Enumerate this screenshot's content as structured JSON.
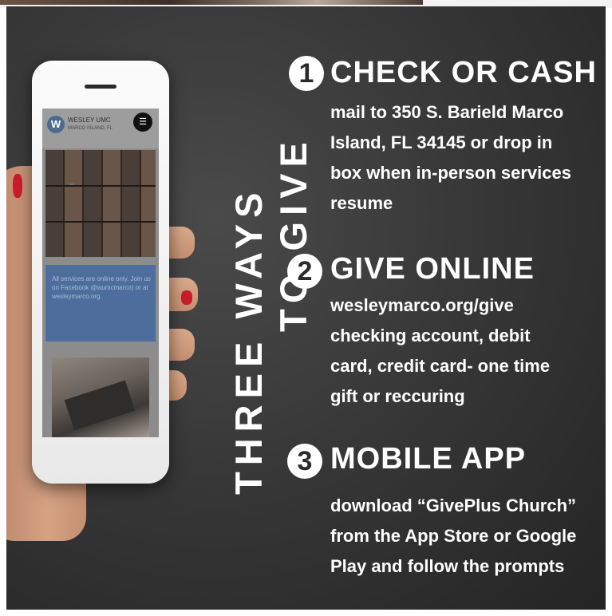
{
  "title_line1": "THREE WAYS",
  "title_line2": "TO GIVE",
  "phone_screen": {
    "site_name": "WESLEY UMC",
    "site_location": "MARCO ISLAND, FL",
    "logo_letter": "W",
    "menu_symbol": "☰",
    "notice": "All services are online only. Join us on Facebook @wumcmarco) or at wesleymarco.org."
  },
  "sections": [
    {
      "number": "1",
      "heading": "CHECK OR CASH",
      "lines": [
        "mail to 350 S. Barield Marco",
        "Island, FL 34145 or drop in",
        "box when in-person services",
        "resume"
      ]
    },
    {
      "number": "2",
      "heading": "GIVE ONLINE",
      "lines": [
        "wesleymarco.org/give",
        "checking account, debit",
        "card, credit card- one time",
        "gift or reccuring"
      ]
    },
    {
      "number": "3",
      "heading": "MOBILE APP",
      "lines": [
        "download “GivePlus Church”",
        "from the App Store or Google",
        "Play and follow the prompts"
      ]
    }
  ]
}
